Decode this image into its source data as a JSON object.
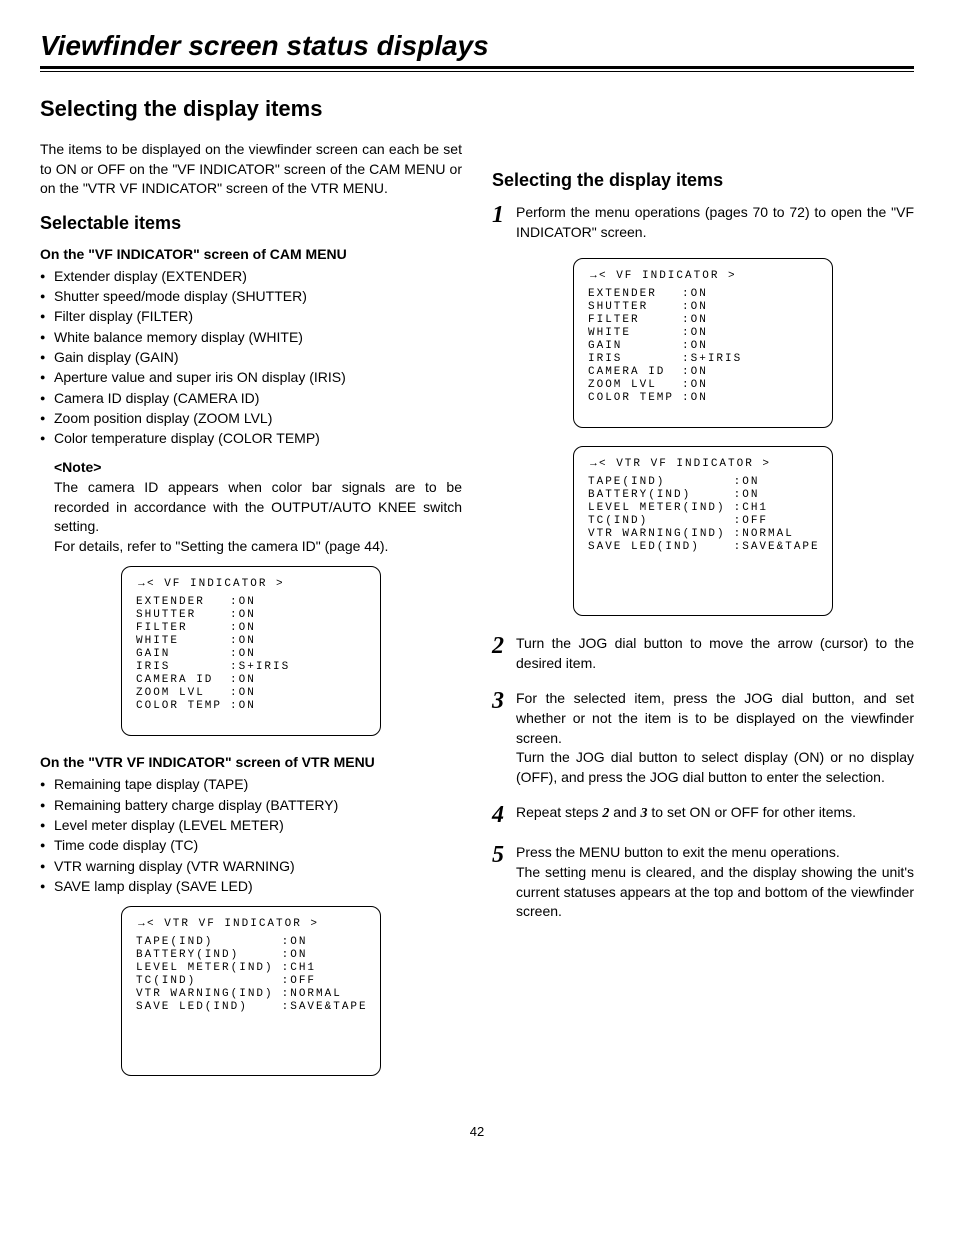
{
  "page_title": "Viewfinder screen status displays",
  "main_heading": "Selecting the display items",
  "intro": "The items to be displayed on the viewfinder screen can each be set to ON or OFF on the \"VF INDICATOR\" screen of the CAM MENU or on the \"VTR VF INDICATOR\" screen of the VTR MENU.",
  "selectable_heading": "Selectable items",
  "cam_heading": "On the \"VF INDICATOR\" screen of CAM MENU",
  "cam_bullets": [
    "Extender display (EXTENDER)",
    "Shutter speed/mode display (SHUTTER)",
    "Filter display (FILTER)",
    "White balance memory display (WHITE)",
    "Gain display (GAIN)",
    "Aperture value and super iris ON display (IRIS)",
    "Camera ID display (CAMERA ID)",
    "Zoom position display (ZOOM LVL)",
    "Color temperature display (COLOR TEMP)"
  ],
  "note_title": "<Note>",
  "note_body1": "The camera ID appears when color bar signals are to be recorded in accordance with the OUTPUT/AUTO KNEE switch setting.",
  "note_body2": "For details, refer to \"Setting the camera ID\" (page 44).",
  "vf_menu": {
    "title": "< VF INDICATOR >",
    "rows": [
      [
        "EXTENDER",
        ":ON"
      ],
      [
        "SHUTTER",
        ":ON"
      ],
      [
        "FILTER",
        ":ON"
      ],
      [
        "WHITE",
        ":ON"
      ],
      [
        "GAIN",
        ":ON"
      ],
      [
        "IRIS",
        ":S+IRIS"
      ],
      [
        "CAMERA ID",
        ":ON"
      ],
      [
        "ZOOM LVL",
        ":ON"
      ],
      [
        "COLOR TEMP",
        ":ON"
      ]
    ]
  },
  "vtr_heading": "On the \"VTR VF INDICATOR\" screen of VTR MENU",
  "vtr_bullets": [
    "Remaining tape display (TAPE)",
    "Remaining battery charge display (BATTERY)",
    "Level meter display (LEVEL METER)",
    "Time code display (TC)",
    "VTR warning display (VTR WARNING)",
    "SAVE lamp display (SAVE LED)"
  ],
  "vtr_menu": {
    "title": "< VTR VF INDICATOR >",
    "rows": [
      [
        "TAPE(IND)",
        ":ON"
      ],
      [
        "BATTERY(IND)",
        ":ON"
      ],
      [
        "LEVEL METER(IND)",
        ":CH1"
      ],
      [
        "TC(IND)",
        ":OFF"
      ],
      [
        "VTR WARNING(IND)",
        ":NORMAL"
      ],
      [
        "SAVE LED(IND)",
        ":SAVE&TAPE"
      ]
    ]
  },
  "right_heading": "Selecting the display items",
  "steps": {
    "s1": "Perform the menu operations (pages 70 to 72) to open the \"VF INDICATOR\" screen.",
    "s2": "Turn the JOG dial button to move the arrow (cursor) to the desired item.",
    "s3a": "For the selected item, press the JOG dial button, and set whether or not the item is to be displayed on the viewfinder screen.",
    "s3b": "Turn the JOG dial button to select display (ON) or no display (OFF), and press the JOG dial button to enter the selection.",
    "s4_pre": "Repeat steps ",
    "s4_mid": " and ",
    "s4_post": " to set ON or OFF for other items.",
    "s4_n2": "2",
    "s4_n3": "3",
    "s5a": "Press the MENU button to exit the menu operations.",
    "s5b": "The setting menu is cleared, and the display showing the unit's current statuses appears at the top and bottom of the viewfinder screen."
  },
  "nums": {
    "n1": "1",
    "n2": "2",
    "n3": "3",
    "n4": "4",
    "n5": "5"
  },
  "page_number": "42",
  "arrow": "→"
}
